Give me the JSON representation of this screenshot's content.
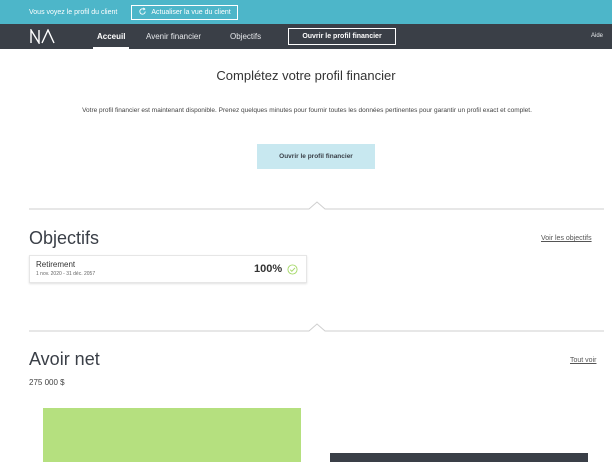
{
  "banner": {
    "message": "Vous voyez le profil du client",
    "refresh_label": "Actualiser la vue du client"
  },
  "nav": {
    "logo": "N\\",
    "items": [
      {
        "label": "Acceuil",
        "active": true
      },
      {
        "label": "Avenir financier",
        "active": false
      },
      {
        "label": "Objectifs",
        "active": false
      }
    ],
    "cta_label": "Ouvrir le profil financier",
    "help_label": "Aide"
  },
  "profile": {
    "title": "Complétez votre profil financier",
    "description": "Votre profil financier est maintenant disponible. Prenez quelques minutes pour fournir toutes les données pertinentes pour garantir un profil exact et complet.",
    "button_label": "Ouvrir le profil financier"
  },
  "objectifs": {
    "title": "Objectifs",
    "link_label": "Voir les objectifs",
    "goals": [
      {
        "name": "Retirement",
        "dates": "1 nov. 2020 - 31 déc. 2057",
        "percent": "100%"
      }
    ]
  },
  "avoir_net": {
    "title": "Avoir net",
    "value": "275 000 $",
    "link_label": "Tout voir"
  },
  "colors": {
    "banner": "#4db6c9",
    "nav": "#3a3f47",
    "accent_button": "#c8e8f0",
    "asset_bar": "#b5e07f",
    "liability_bar": "#3a3f47",
    "check": "#a6d96a"
  }
}
